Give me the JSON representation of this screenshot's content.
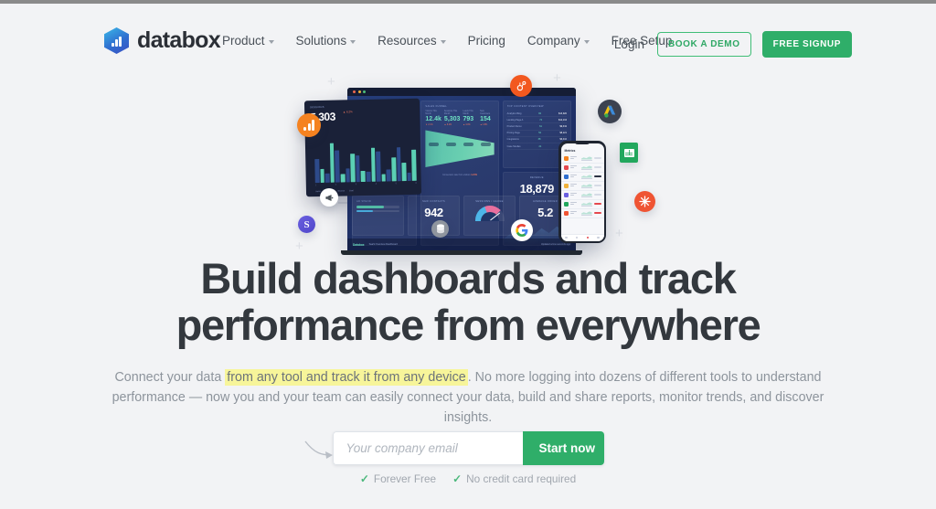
{
  "header": {
    "logo_text": "databox",
    "nav": [
      {
        "label": "Product",
        "has_caret": true
      },
      {
        "label": "Solutions",
        "has_caret": true
      },
      {
        "label": "Resources",
        "has_caret": true
      },
      {
        "label": "Pricing",
        "has_caret": false
      },
      {
        "label": "Company",
        "has_caret": true
      },
      {
        "label": "Free Setup",
        "has_caret": false
      }
    ],
    "login_label": "Login",
    "demo_button": "BOOK A DEMO",
    "signup_button": "FREE SIGNUP"
  },
  "hero": {
    "headline_line1": "Build dashboards and track",
    "headline_line2": "performance from everywhere",
    "sub_part1": "Connect your data ",
    "sub_highlight": "from any tool and track it from any device",
    "sub_part2": ". No more logging into dozens of different tools to understand performance — now you and your team can easily connect your data, build and share reports, monitor trends, and discover insights."
  },
  "form": {
    "email_placeholder": "Your company email",
    "email_value": "",
    "submit_label": "Start now",
    "submit_arrow": "→",
    "perks": [
      {
        "check": "✓",
        "label": "Forever Free"
      },
      {
        "check": "✓",
        "label": "No credit card required"
      }
    ]
  },
  "dashboard": {
    "float_card": {
      "title": "SESSIONS",
      "subtitle": "Last 6 days • Chart 1",
      "value": "5,303",
      "delta": "▲ 6.2%",
      "delta_note": "Sessions, Last 6",
      "axis": [
        "1",
        "2",
        "3",
        "4",
        "5",
        "6"
      ],
      "legend": [
        "Users",
        "Sessions",
        "Bounce",
        "Goal",
        "Rate"
      ],
      "bars_teal": [
        30,
        86,
        18,
        62,
        24,
        74,
        16,
        52,
        40,
        68,
        22,
        58,
        14,
        46,
        28
      ],
      "bars_dark": [
        52,
        20,
        70,
        30,
        58,
        22,
        66,
        26,
        74,
        18,
        62,
        34,
        70,
        24,
        60
      ]
    },
    "funnel": {
      "title": "SALES FUNNEL",
      "metrics": [
        {
          "label": "Visitors This Month",
          "value": "12.4k",
          "delta": "▼ 2.1%"
        },
        {
          "label": "Sessions This Month",
          "value": "5,303",
          "delta": "▲ 6.2%"
        },
        {
          "label": "Leads This Month",
          "value": "793",
          "delta": "▲ 4.0%"
        },
        {
          "label": "New Customers",
          "value": "154",
          "delta": "▲ 1.8%"
        }
      ],
      "footer_label": "Conversion rate from visitors",
      "footer_value": "1.24%",
      "footer_delta": "▼ 0.3%"
    },
    "top_table": {
      "title": "TOP CONTENT OVERVIEW",
      "columns": [
        "Page",
        "Views",
        "Value"
      ],
      "rows": [
        {
          "name": "Analytics Blog",
          "views": "82",
          "value": "$13,920"
        },
        {
          "name": "Landing Page A",
          "views": "74",
          "value": "$12,104"
        },
        {
          "name": "Product Demo",
          "views": "61",
          "value": "$9,332"
        },
        {
          "name": "Pricing Page",
          "views": "52",
          "value": "$8,221"
        },
        {
          "name": "Integrations",
          "views": "38",
          "value": "$6,410"
        },
        {
          "name": "Case Studies",
          "views": "21",
          "value": "$3,180"
        }
      ]
    },
    "revenue": {
      "title": "REVENUE",
      "value": "18,879",
      "delta": "▲ 5.1%"
    },
    "bottom_tiles": [
      {
        "title": "AD SPEND",
        "value": ""
      },
      {
        "title": "NEW CONTACTS",
        "value": "942",
        "delta": "▲ 4.4%"
      },
      {
        "title": "SESSIONS / GAUGE",
        "value": ""
      },
      {
        "title": "AVERAGE ORDER",
        "value": "5.2",
        "delta": "▲ 0.4%"
      }
    ],
    "footer": {
      "brand": "Databox",
      "name": "SaaS Overview Dashboard",
      "meta": "Updated a few seconds ago"
    }
  },
  "phone": {
    "title": "Metrics",
    "rows": [
      {
        "color": "#f58220",
        "value": "+12%"
      },
      {
        "color": "#e5484d",
        "value": "+4.1%"
      },
      {
        "color": "#2f6fd0",
        "value": "New 38"
      },
      {
        "color": "#f0b23c",
        "value": "+2.8%"
      },
      {
        "color": "#6a5fe0",
        "value": "-1.2%"
      },
      {
        "color": "#22a75d",
        "value": "+9.6%"
      },
      {
        "color": "#ef5433",
        "value": "+0.8%"
      }
    ]
  },
  "integrations": [
    {
      "name": "google-analytics-icon",
      "color": "#f58220"
    },
    {
      "name": "megaphone-icon",
      "color": "#ffffff"
    },
    {
      "name": "shopify-s-icon",
      "color": "#5b4fd6",
      "glyph": "S"
    },
    {
      "name": "hubspot-icon",
      "color": "#f2581f"
    },
    {
      "name": "google-ads-icon",
      "color": "#3c4250"
    },
    {
      "name": "google-sheets-icon",
      "color": "#22a75d"
    },
    {
      "name": "gear-icon",
      "color": "#ef5433"
    },
    {
      "name": "database-icon",
      "color": "#8f959e"
    },
    {
      "name": "google-icon",
      "color": "#ffffff"
    }
  ],
  "colors": {
    "page_bg": "#f2f3f5",
    "brand_green": "#2fae69",
    "headline": "#33383e",
    "body_text": "#8d949c",
    "highlight": "#f7f59a",
    "dashboard_blue": "#1f3168",
    "accent_teal": "#6fe3c4"
  }
}
